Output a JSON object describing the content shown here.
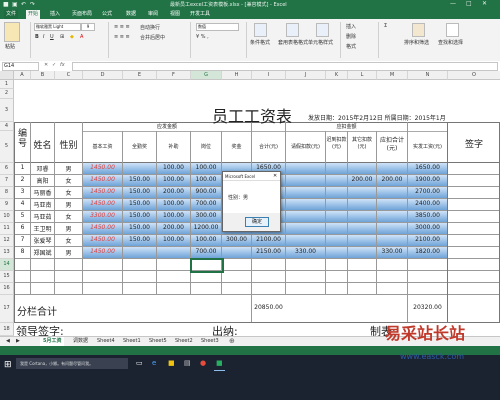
{
  "window": {
    "title": "最新员工excel工资表模板.xlsx - [兼容模式] - Excel"
  },
  "tabs": [
    "文件",
    "开始",
    "插入",
    "页面布局",
    "公式",
    "数据",
    "审阅",
    "视图",
    "开发工具"
  ],
  "ribbon": {
    "font_name": "微软雅黑 Light",
    "font_size": "9",
    "paste_label": "粘贴",
    "wrap_label": "自动换行",
    "merge_label": "合并后居中",
    "number_format": "数值",
    "cond_format_label": "条件格式",
    "table_format_label": "套用表格格式",
    "cell_style_label": "单元格样式",
    "insert_label": "插入",
    "delete_label": "删除",
    "format_label": "格式",
    "sort_label": "排序和筛选",
    "find_label": "查找和选择"
  },
  "formula_bar": {
    "name_box": "G14",
    "fx": "fx"
  },
  "columns": [
    "A",
    "B",
    "C",
    "D",
    "E",
    "F",
    "G",
    "H",
    "I",
    "J",
    "K",
    "L",
    "M",
    "N",
    "O"
  ],
  "sheet": {
    "title": "员工工资表",
    "issue_date": "发放日期：2015年2月12日 所属日期：2015年1月",
    "h_number": "编号",
    "h_name": "姓名",
    "h_gender": "性别",
    "h_pay_group": "应发金额",
    "h_deduct_group": "应扣金额",
    "h_base": "基本工资",
    "h_bonus1": "全勤奖",
    "h_subsidy": "补助",
    "h_post": "岗位",
    "h_bonus2": "奖金",
    "h_total": "合计(元)",
    "h_leave": "请假扣款(元)",
    "h_late": "迟到扣款(元)",
    "h_other": "其它扣款(元)",
    "h_deduct_total": "应扣合计(元)",
    "h_actual": "实发工资(元)",
    "h_sign": "签字",
    "subtotal_label": "分栏合计",
    "subtotal_total": "20850.00",
    "subtotal_actual": "20320.00",
    "leader_sign": "领导签字:",
    "cashier": "出纳:",
    "preparer": "制表:"
  },
  "rows": [
    {
      "r": "6",
      "no": "1",
      "name": "邓睿",
      "gender": "男",
      "base": "1450.00",
      "bonus1": "",
      "subsidy": "100.00",
      "post": "100.00",
      "total": "1650.00",
      "leave": "",
      "late": "",
      "other": "",
      "dtotal": "",
      "actual": "1650.00"
    },
    {
      "r": "7",
      "no": "2",
      "name": "高阳",
      "gender": "女",
      "base": "1450.00",
      "bonus1": "150.00",
      "subsidy": "100.00",
      "post": "100.00",
      "total": "",
      "leave": "",
      "late": "",
      "other": "200.00",
      "dtotal": "200.00",
      "actual": "1900.00"
    },
    {
      "r": "8",
      "no": "3",
      "name": "马丽香",
      "gender": "女",
      "base": "1450.00",
      "bonus1": "150.00",
      "subsidy": "200.00",
      "post": "900.00",
      "total": "",
      "leave": "",
      "late": "",
      "other": "",
      "dtotal": "",
      "actual": "2700.00"
    },
    {
      "r": "9",
      "no": "4",
      "name": "马亚南",
      "gender": "男",
      "base": "1450.00",
      "bonus1": "150.00",
      "subsidy": "100.00",
      "post": "700.00",
      "total": "",
      "leave": "",
      "late": "",
      "other": "",
      "dtotal": "",
      "actual": "2400.00"
    },
    {
      "r": "10",
      "no": "5",
      "name": "马亚茹",
      "gender": "女",
      "base": "3300.00",
      "bonus1": "150.00",
      "subsidy": "100.00",
      "post": "300.00",
      "total": "",
      "leave": "",
      "late": "",
      "other": "",
      "dtotal": "",
      "actual": "3850.00"
    },
    {
      "r": "11",
      "no": "6",
      "name": "王卫明",
      "gender": "男",
      "base": "1450.00",
      "bonus1": "150.00",
      "subsidy": "200.00",
      "post": "1200.00",
      "total": "",
      "leave": "",
      "late": "",
      "other": "",
      "dtotal": "",
      "actual": "3000.00"
    },
    {
      "r": "12",
      "no": "7",
      "name": "张爱琴",
      "gender": "女",
      "base": "1450.00",
      "bonus1": "150.00",
      "subsidy": "100.00",
      "post": "100.00",
      "bonus2": "300.00",
      "total": "2100.00",
      "leave": "",
      "late": "",
      "other": "",
      "dtotal": "",
      "actual": "2100.00"
    },
    {
      "r": "13",
      "no": "8",
      "name": "郑国斌",
      "gender": "男",
      "base": "1450.00",
      "bonus1": "",
      "subsidy": "",
      "post": "700.00",
      "bonus2": "",
      "total": "2150.00",
      "leave": "330.00",
      "late": "",
      "other": "",
      "dtotal": "330.00",
      "actual": "1820.00"
    }
  ],
  "row_numbers": {
    "r1": "1",
    "r2": "2",
    "r3": "3",
    "r4": "4",
    "r5": "5",
    "r14": "14",
    "r15": "15",
    "r16": "16",
    "r17": "17",
    "r18": "18",
    "r19": "19"
  },
  "dialog": {
    "title": "Microsoft Excel",
    "message": "性别：男",
    "ok": "确定"
  },
  "sheet_tabs": [
    "5月工资",
    "调数据",
    "Sheet4",
    "Sheet1",
    "Sheet5",
    "Sheet2",
    "Sheet3"
  ],
  "taskbar": {
    "search_placeholder": "我是 Cortana，小娜。有问题尽管问我。"
  },
  "watermark": {
    "text": "易采站长站",
    "url": "www.easck.com"
  },
  "colors": {
    "excel_green": "#217346",
    "row_blue": "#6ea3d8",
    "red_text": "#e04040"
  }
}
